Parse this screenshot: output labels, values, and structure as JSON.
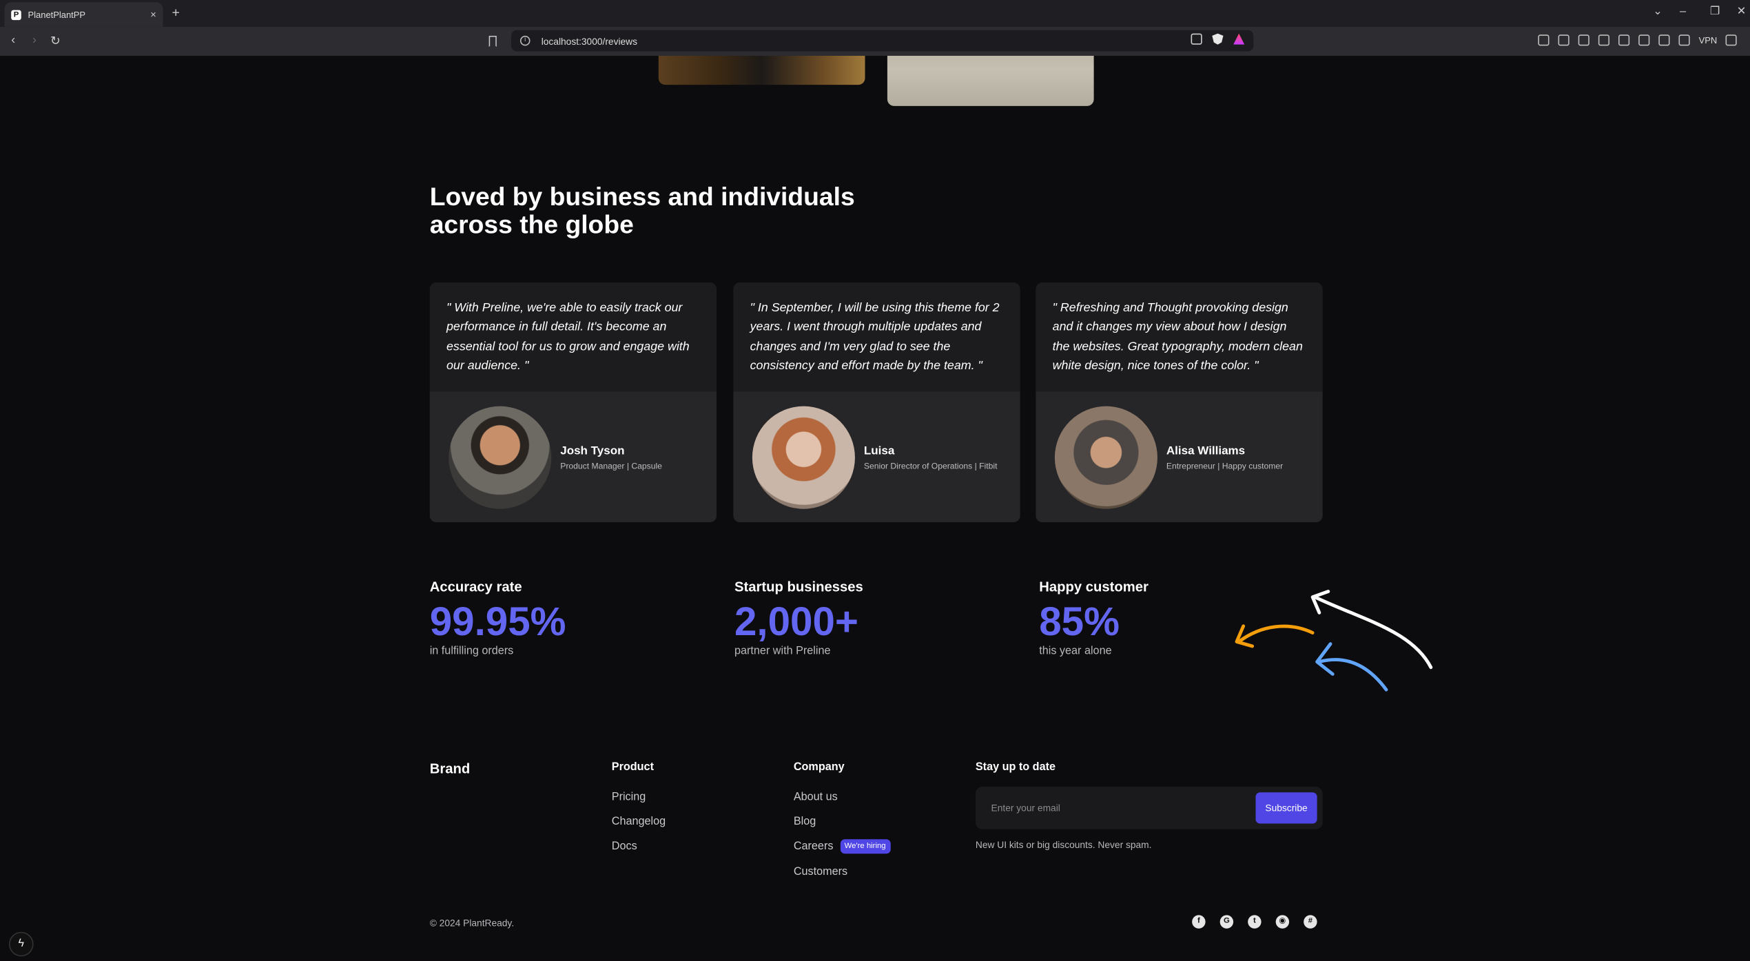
{
  "browser": {
    "tab_title": "PlanetPlantPP",
    "favicon_letter": "P",
    "url": "localhost:3000/reviews",
    "vpn_label": "VPN",
    "new_tab": "+",
    "tab_close": "×"
  },
  "reviews": {
    "headline": "Loved by business and individuals across the globe",
    "cards": [
      {
        "quote": "\" With Preline, we're able to easily track our performance in full detail. It's become an essential tool for us to grow and engage with our audience. \"",
        "name": "Josh Tyson",
        "role": "Product Manager | Capsule"
      },
      {
        "quote": "\" In September, I will be using this theme for 2 years. I went through multiple updates and changes and I'm very glad to see the consistency and effort made by the team. \"",
        "name": "Luisa",
        "role": "Senior Director of Operations | Fitbit"
      },
      {
        "quote": "\" Refreshing and Thought provoking design and it changes my view about how I design the websites. Great typography, modern clean white design, nice tones of the color. \"",
        "name": "Alisa Williams",
        "role": "Entrepreneur | Happy customer"
      }
    ]
  },
  "stats": [
    {
      "label": "Accuracy rate",
      "value": "99.95%",
      "sub": "in fulfilling orders"
    },
    {
      "label": "Startup businesses",
      "value": "2,000+",
      "sub": "partner with Preline"
    },
    {
      "label": "Happy customer",
      "value": "85%",
      "sub": "this year alone"
    }
  ],
  "colors": {
    "accent": "#6366f1",
    "button": "#4f46e5",
    "arrow_orange": "#f59e0b",
    "arrow_blue": "#60a5fa"
  },
  "footer": {
    "brand": "Brand",
    "product": {
      "heading": "Product",
      "links": [
        "Pricing",
        "Changelog",
        "Docs"
      ]
    },
    "company": {
      "heading": "Company",
      "links": [
        "About us",
        "Blog",
        "Careers",
        "Customers"
      ],
      "badge": "We're hiring"
    },
    "newsletter": {
      "heading": "Stay up to date",
      "placeholder": "Enter your email",
      "button": "Subscribe",
      "note": "New UI kits or big discounts. Never spam."
    },
    "copyright": "© 2024 PlantReady.",
    "socials": [
      "facebook-icon",
      "google-icon",
      "twitter-icon",
      "github-icon",
      "slack-icon"
    ]
  }
}
